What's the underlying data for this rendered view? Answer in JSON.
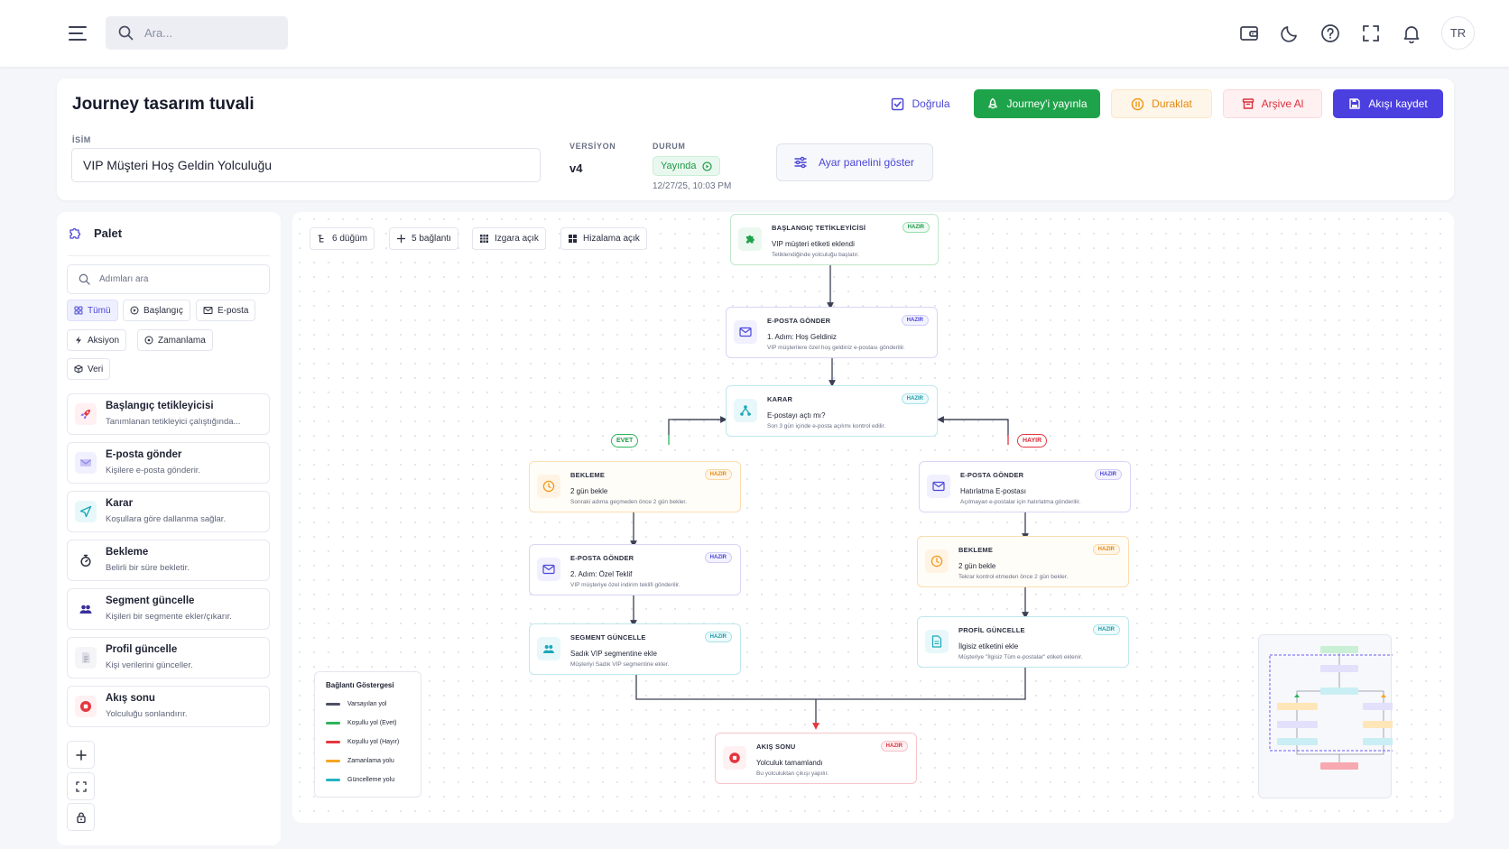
{
  "topbar": {
    "search_placeholder": "Ara...",
    "icons": [
      "menu-icon",
      "search-icon",
      "wallet-icon",
      "moon-icon",
      "help-icon",
      "fullscreen-icon",
      "bell-icon"
    ],
    "language": "TR"
  },
  "header": {
    "title": "Journey tasarım tuvali",
    "buttons": {
      "validate": "Doğrula",
      "publish": "Journey'i yayınla",
      "pause": "Duraklat",
      "archive": "Arşive Al",
      "save": "Akışı kaydet"
    },
    "name_label": "İSİM",
    "name_value": "VIP Müşteri Hoş Geldin Yolculuğu",
    "version_label": "VERSİYON",
    "version_value": "v4",
    "status_label": "DURUM",
    "status_value": "Yayında",
    "status_time": "12/27/25, 10:03 PM",
    "settings_button": "Ayar panelini göster"
  },
  "palette": {
    "title": "Palet",
    "search_placeholder": "Adımları ara",
    "filters": [
      "Tümü",
      "Başlangıç",
      "E-posta",
      "Aksiyon",
      "Zamanlama",
      "Veri"
    ],
    "items": [
      {
        "title": "Başlangıç tetikleyicisi",
        "desc": "Tanımlanan tetikleyici çalıştığında...",
        "icon": "rocket-icon"
      },
      {
        "title": "E-posta gönder",
        "desc": "Kişilere e-posta gönderir.",
        "icon": "email-icon"
      },
      {
        "title": "Karar",
        "desc": "Koşullara göre dallanma sağlar.",
        "icon": "send-icon"
      },
      {
        "title": "Bekleme",
        "desc": "Belirli bir süre bekletir.",
        "icon": "stopwatch-icon"
      },
      {
        "title": "Segment güncelle",
        "desc": "Kişileri bir segmente ekler/çıkarır.",
        "icon": "users-icon"
      },
      {
        "title": "Profil güncelle",
        "desc": "Kişi verilerini günceller.",
        "icon": "document-icon"
      },
      {
        "title": "Akış sonu",
        "desc": "Yolculuğu sonlandırır.",
        "icon": "stop-icon"
      }
    ]
  },
  "canvas": {
    "stats": {
      "nodes": "6 düğüm",
      "links": "5 bağlantı",
      "grid": "Izgara açık",
      "snap": "Hizalama açık"
    },
    "branch_yes": "EVET",
    "branch_no": "HAYIR",
    "nodes": [
      {
        "type": "BAŞLANGIÇ TETİKLEYİCİSİ",
        "badge": "HAZIR",
        "title": "VIP müşteri etiketi eklendi",
        "desc": "Tetiklendiğinde yolculuğu başlatır."
      },
      {
        "type": "E-POSTA GÖNDER",
        "badge": "HAZIR",
        "title": "1. Adım: Hoş Geldiniz",
        "desc": "VIP müşterilere özel hoş geldiniz e-postası gönderilir."
      },
      {
        "type": "KARAR",
        "badge": "HAZIR",
        "title": "E-postayı açtı mı?",
        "desc": "Son 3 gün içinde e-posta açılımı kontrol edilir."
      },
      {
        "type": "BEKLEME",
        "badge": "HAZIR",
        "title": "2 gün bekle",
        "desc": "Sonraki adıma geçmeden önce 2 gün bekler."
      },
      {
        "type": "E-POSTA GÖNDER",
        "badge": "HAZIR",
        "title": "2. Adım: Özel Teklif",
        "desc": "VIP müşteriye özel indirim teklifi gönderilir."
      },
      {
        "type": "SEGMENT GÜNCELLE",
        "badge": "HAZIR",
        "title": "Sadık VIP segmentine ekle",
        "desc": "Müşteriyi Sadık VIP segmentine ekler."
      },
      {
        "type": "E-POSTA GÖNDER",
        "badge": "HAZIR",
        "title": "Hatırlatma E-postası",
        "desc": "Açılmayan e-postalar için hatırlatma gönderilir."
      },
      {
        "type": "BEKLEME",
        "badge": "HAZIR",
        "title": "2 gün bekle",
        "desc": "Tekrar kontrol etmeden önce 2 gün bekler."
      },
      {
        "type": "PROFİL GÜNCELLE",
        "badge": "HAZIR",
        "title": "İlgisiz etiketini ekle",
        "desc": "Müşteriye \"İlgisiz Tüm e-postalar\" etiketi eklenir."
      },
      {
        "type": "AKIŞ SONU",
        "badge": "HAZIR",
        "title": "Yolculuk tamamlandı",
        "desc": "Bu yolculuktan çıkışı yapılır."
      }
    ],
    "legend": {
      "title": "Bağlantı Göstergesi",
      "rows": [
        {
          "label": "Varsayılan yol",
          "color": "#4b5063"
        },
        {
          "label": "Koşullu yol (Evet)",
          "color": "#2db35b"
        },
        {
          "label": "Koşullu yol (Hayır)",
          "color": "#e5363f"
        },
        {
          "label": "Zamanlama yolu",
          "color": "#f5a623"
        },
        {
          "label": "Güncelleme yolu",
          "color": "#23b3c4"
        }
      ]
    }
  }
}
